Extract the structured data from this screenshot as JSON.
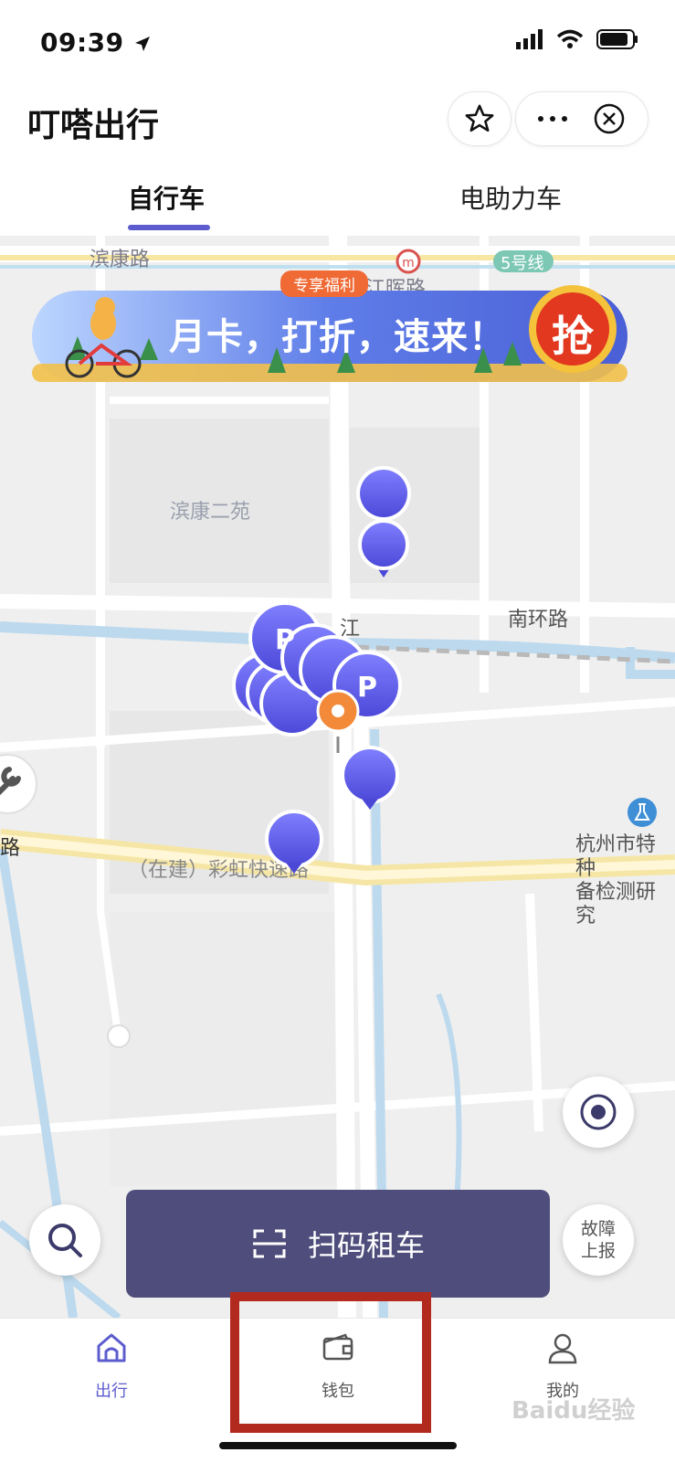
{
  "status_bar": {
    "time": "09:39"
  },
  "header": {
    "title": "叮嗒出行"
  },
  "tabs": [
    {
      "label": "自行车"
    },
    {
      "label": "电助力车"
    }
  ],
  "map": {
    "labels": {
      "road_top": "滨康路",
      "metro_line": "5号线",
      "partial_road": "江晖路",
      "community": "滨康二苑",
      "south_ring": "南环路",
      "river_char": "江",
      "expressway": "（在建）彩虹快速路",
      "left_edge": "路",
      "institute_line1": "杭州市特种",
      "institute_line2": "备检测研究"
    }
  },
  "banner": {
    "tag": "专享福利",
    "text": "月卡，打折，速来！",
    "cta": "抢"
  },
  "buttons": {
    "scan": "扫码租车",
    "report_line1": "故障",
    "report_line2": "上报"
  },
  "bottom_nav": [
    {
      "label": "出行",
      "icon": "home-icon",
      "active": true
    },
    {
      "label": "钱包",
      "icon": "wallet-icon",
      "active": false
    },
    {
      "label": "我的",
      "icon": "user-icon",
      "active": false
    }
  ],
  "watermark": "Baidu经验",
  "colors": {
    "accent": "#5c5ccf",
    "scan_button": "#4f4d7b",
    "highlight": "#b22a1e"
  }
}
